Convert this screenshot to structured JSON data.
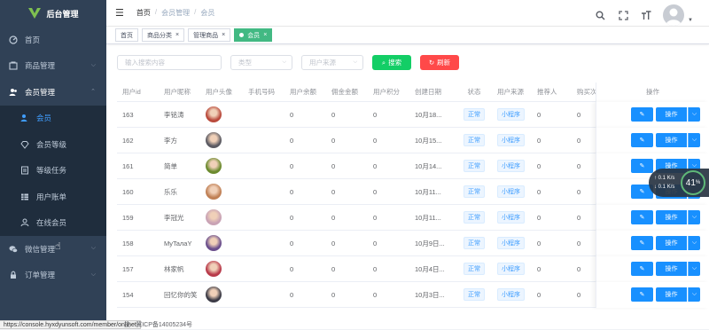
{
  "app": {
    "title": "后台管理"
  },
  "sidebar": {
    "items": [
      {
        "label": "首页",
        "icon": "dashboard-icon"
      },
      {
        "label": "商品管理",
        "icon": "shop-icon"
      },
      {
        "label": "会员管理",
        "icon": "members-icon"
      },
      {
        "label": "会员",
        "icon": "user-icon"
      },
      {
        "label": "会员等级",
        "icon": "diamond-icon"
      },
      {
        "label": "等级任务",
        "icon": "task-icon"
      },
      {
        "label": "用户账单",
        "icon": "table-icon"
      },
      {
        "label": "在线会员",
        "icon": "online-user-icon"
      },
      {
        "label": "微信管理",
        "icon": "wechat-icon"
      },
      {
        "label": "订单管理",
        "icon": "lock-icon"
      }
    ]
  },
  "breadcrumb": {
    "home": "首页",
    "group": "会员管理",
    "current": "会员"
  },
  "tags": {
    "t1": "首页",
    "t2": "商品分类",
    "t3": "管理商品",
    "t4": "会员"
  },
  "filters": {
    "search_placeholder": "输入搜索内容",
    "type_placeholder": "类型",
    "source_placeholder": "用户来源",
    "search_btn": "搜索",
    "refresh_btn": "刷新"
  },
  "table": {
    "headers": [
      "用户id",
      "用户昵称",
      "用户头像",
      "手机号码",
      "用户余额",
      "佣金金额",
      "用户积分",
      "创建日期",
      "状态",
      "用户来源",
      "推荐人",
      "购买次"
    ],
    "ops_header": "操作",
    "edit_label": "✎",
    "op_label": "操作",
    "rows": [
      {
        "id": "163",
        "name": "李铭涛",
        "phone": "",
        "balance": "0",
        "commission": "0",
        "points": "0",
        "date": "10月18...",
        "status": "正常",
        "source": "小程序",
        "ref": "0",
        "buys": "0",
        "avatar_color": "#b94a3c"
      },
      {
        "id": "162",
        "name": "李方",
        "phone": "",
        "balance": "0",
        "commission": "0",
        "points": "0",
        "date": "10月15...",
        "status": "正常",
        "source": "小程序",
        "ref": "0",
        "buys": "0",
        "avatar_color": "#5b5a62"
      },
      {
        "id": "161",
        "name": "简单",
        "phone": "",
        "balance": "0",
        "commission": "0",
        "points": "0",
        "date": "10月14...",
        "status": "正常",
        "source": "小程序",
        "ref": "0",
        "buys": "0",
        "avatar_color": "#6b8a2e"
      },
      {
        "id": "160",
        "name": "乐乐",
        "phone": "",
        "balance": "0",
        "commission": "0",
        "points": "0",
        "date": "10月11...",
        "status": "正常",
        "source": "小程序",
        "ref": "0",
        "buys": "0",
        "avatar_color": "#c08055"
      },
      {
        "id": "159",
        "name": "李冠光",
        "phone": "",
        "balance": "0",
        "commission": "0",
        "points": "0",
        "date": "10月11...",
        "status": "正常",
        "source": "小程序",
        "ref": "0",
        "buys": "0",
        "avatar_color": "#c9a3b5"
      },
      {
        "id": "158",
        "name": "MyTaлaY",
        "phone": "",
        "balance": "0",
        "commission": "0",
        "points": "0",
        "date": "10月9日...",
        "status": "正常",
        "source": "小程序",
        "ref": "0",
        "buys": "0",
        "avatar_color": "#6a4e8c"
      },
      {
        "id": "157",
        "name": "林家帆",
        "phone": "",
        "balance": "0",
        "commission": "0",
        "points": "0",
        "date": "10月4日...",
        "status": "正常",
        "source": "小程序",
        "ref": "0",
        "buys": "0",
        "avatar_color": "#b83a4a"
      },
      {
        "id": "154",
        "name": "回忆你的笑",
        "phone": "",
        "balance": "0",
        "commission": "0",
        "points": "0",
        "date": "10月3日...",
        "status": "正常",
        "source": "小程序",
        "ref": "0",
        "buys": "0",
        "avatar_color": "#3b3b46"
      }
    ]
  },
  "status_bar": {
    "url": "https://console.hyxdyunsoft.com/member/onlinet",
    "icp": "技 · 冀ICP备14005234号"
  },
  "net_widget": {
    "percent": "41",
    "unit": "%",
    "up": "0.1",
    "down": "0.1",
    "speed_unit": "K/s"
  },
  "colors": {
    "sidebar": "#304156",
    "primary": "#1890ff",
    "success": "#13ce66",
    "danger": "#ff4949",
    "tag_active": "#42b983"
  }
}
